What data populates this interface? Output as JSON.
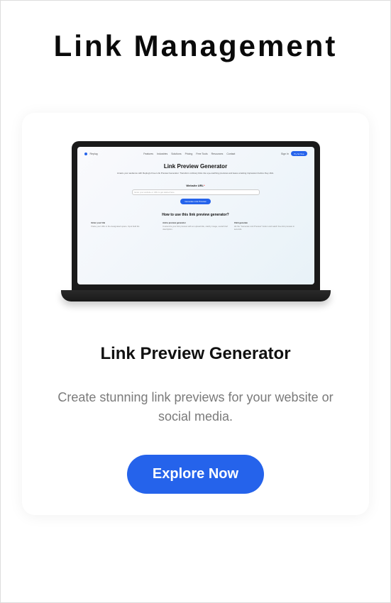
{
  "page": {
    "title": "Link Management"
  },
  "card": {
    "title": "Link Preview Generator",
    "description": "Create stunning link previews for your website or social media.",
    "cta": "Explore Now"
  },
  "mockup": {
    "brand": "Replug",
    "nav": [
      "Features",
      "Industries",
      "Solutions",
      "Pricing",
      "Free Tools",
      "Resources",
      "Contact"
    ],
    "signin": "Sign In",
    "signup": "Try for free",
    "hero_title": "Link Preview Generator",
    "hero_sub": "Amaze your audience with Replug's Free Link Preview Generator. Transform ordinary links into eye-catching previews and leave a lasting impression before they click.",
    "url_label": "Website URL",
    "url_placeholder": "Enter your website or URL to get started here",
    "button": "Generate Link Preview",
    "howto_title": "How to use this link preview generator?",
    "cols": [
      {
        "title": "Enter your link",
        "text": "Paste your URL in the designated space. Input field list."
      },
      {
        "title": "Add a preview generator",
        "text": "Customize your link preview with an upload title, catchy image, social brief description."
      },
      {
        "title": "Click generate",
        "text": "Hit the \"Generate Link Preview\" button and watch free link preview in seconds."
      }
    ]
  }
}
